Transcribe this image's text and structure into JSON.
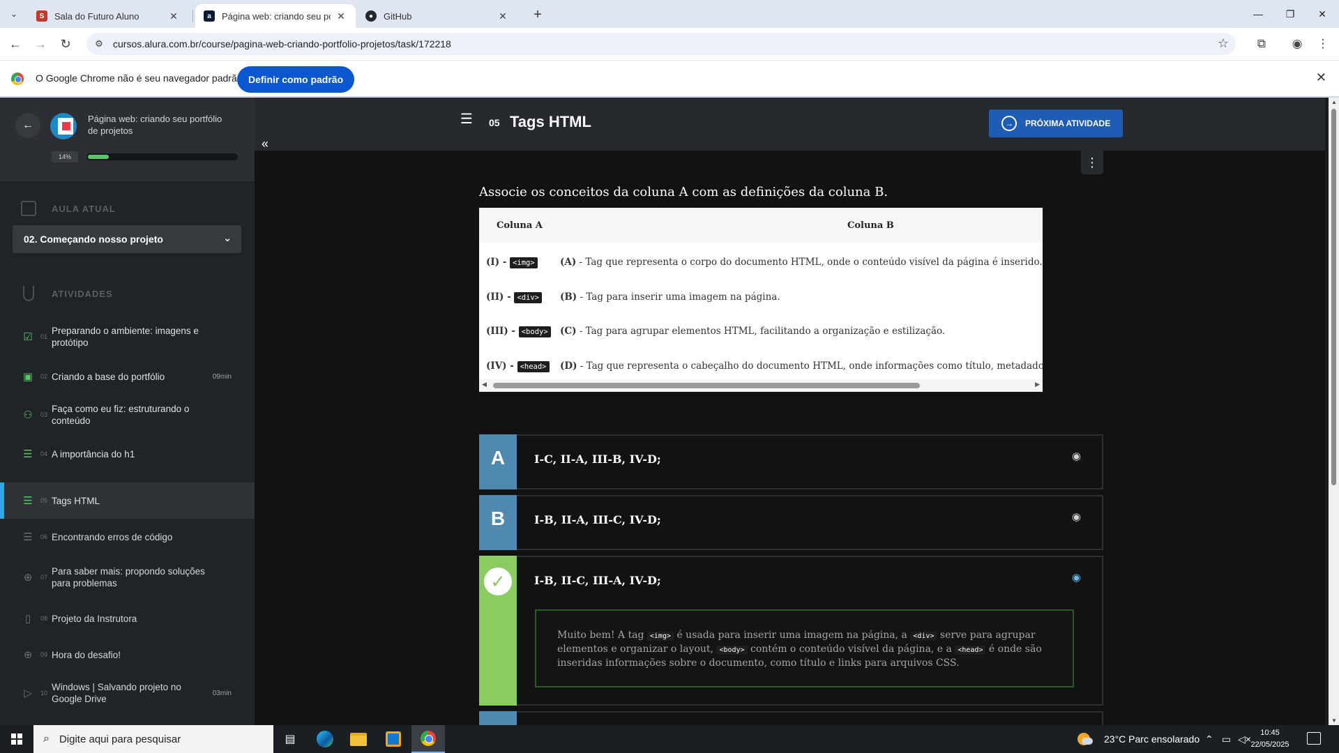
{
  "browser": {
    "tabs": [
      {
        "title": "Sala do Futuro Aluno",
        "favicon": "sala-futuro-icon",
        "active": false
      },
      {
        "title": "Página web: criando seu portfó",
        "favicon": "alura-icon",
        "active": true
      },
      {
        "title": "GitHub",
        "favicon": "github-icon",
        "active": false
      }
    ],
    "new_tab": "+",
    "url": "cursos.alura.com.br/course/pagina-web-criando-portfolio-projetos/task/172218",
    "infobar": {
      "message": "O Google Chrome não é seu navegador padrão",
      "button": "Definir como padrão"
    }
  },
  "sidebar": {
    "course_title": "Página web: criando seu portfólio de projetos",
    "progress_label": "14%",
    "progress_value": 14,
    "current_section_label": "AULA ATUAL",
    "current_lesson": "02. Começando nosso projeto",
    "activities_label": "ATIVIDADES",
    "activities": [
      {
        "num": "01",
        "title": "Preparando o ambiente: imagens e protótipo",
        "duration": "",
        "icon": "clipboard-check-icon",
        "state": "done"
      },
      {
        "num": "02",
        "title": "Criando a base do portfólio",
        "duration": "09min",
        "icon": "play-icon",
        "state": "done"
      },
      {
        "num": "03",
        "title": "Faça como eu fiz: estruturando o conteúdo",
        "duration": "",
        "icon": "binoculars-icon",
        "state": "done"
      },
      {
        "num": "04",
        "title": "A importância do h1",
        "duration": "",
        "icon": "list-icon",
        "state": "done"
      },
      {
        "num": "05",
        "title": "Tags HTML",
        "duration": "",
        "icon": "list-icon",
        "state": "active"
      },
      {
        "num": "06",
        "title": "Encontrando erros de código",
        "duration": "",
        "icon": "list-icon",
        "state": "todo"
      },
      {
        "num": "07",
        "title": "Para saber mais: propondo soluções para problemas",
        "duration": "",
        "icon": "plus-circle-icon",
        "state": "todo"
      },
      {
        "num": "08",
        "title": "Projeto da Instrutora",
        "duration": "",
        "icon": "book-icon",
        "state": "todo"
      },
      {
        "num": "09",
        "title": "Hora do desafio!",
        "duration": "",
        "icon": "plus-circle-icon",
        "state": "todo"
      },
      {
        "num": "10",
        "title": "Windows | Salvando projeto no Google Drive",
        "duration": "03min",
        "icon": "play-icon",
        "state": "todo"
      }
    ]
  },
  "main": {
    "task_number": "05",
    "task_title": "Tags HTML",
    "next_button": "PRÓXIMA ATIVIDADE",
    "question": "Associe os conceitos da coluna A com as definições da coluna B.",
    "table": {
      "headers": [
        "Coluna A",
        "Coluna B"
      ],
      "rows": [
        {
          "a_num": "(I) - ",
          "a_tag": "<img>",
          "b_letter": "(A)",
          "b_text": " - Tag que representa o corpo do documento HTML, onde o conteúdo visível da página é inserido."
        },
        {
          "a_num": "(II) - ",
          "a_tag": "<div>",
          "b_letter": "(B)",
          "b_text": " - Tag para inserir uma imagem na página."
        },
        {
          "a_num": "(III) - ",
          "a_tag": "<body>",
          "b_letter": "(C)",
          "b_text": " - Tag para agrupar elementos HTML, facilitando a organização e estilização."
        },
        {
          "a_num": "(IV) - ",
          "a_tag": "<head>",
          "b_letter": "(D)",
          "b_text": " - Tag que representa o cabeçalho do documento HTML, onde informações como título, metadados e links p"
        }
      ]
    },
    "options": [
      {
        "letter": "A",
        "text": "I-C, II-A, III-B, IV-D;",
        "correct": false
      },
      {
        "letter": "B",
        "text": "I-B, II-A, III-C, IV-D;",
        "correct": false
      },
      {
        "letter": "C",
        "text": "I-B, II-C, III-A, IV-D;",
        "correct": true
      }
    ],
    "feedback": {
      "t1": "Muito bem! A tag ",
      "c1": "<img>",
      "t2": " é usada para inserir uma imagem na página, a ",
      "c2": "<div>",
      "t3": " serve para agrupar elementos e organizar o layout, ",
      "c3": "<body>",
      "t4": " contém o conteúdo visível da página, e a ",
      "c4": "<head>",
      "t5": " é onde são inseridas informações sobre o documento, como título e links para arquivos CSS."
    }
  },
  "taskbar": {
    "search_placeholder": "Digite aqui para pesquisar",
    "weather": "23°C  Parc ensolarado",
    "time": "10:45",
    "date": "22/05/2025"
  },
  "colors": {
    "accent_blue": "#1f5cb4",
    "option_letter_bg": "#4f89b0",
    "correct_green": "#8bcc62",
    "progress_green": "#5ac767",
    "active_indicator": "#2aa8e8"
  }
}
